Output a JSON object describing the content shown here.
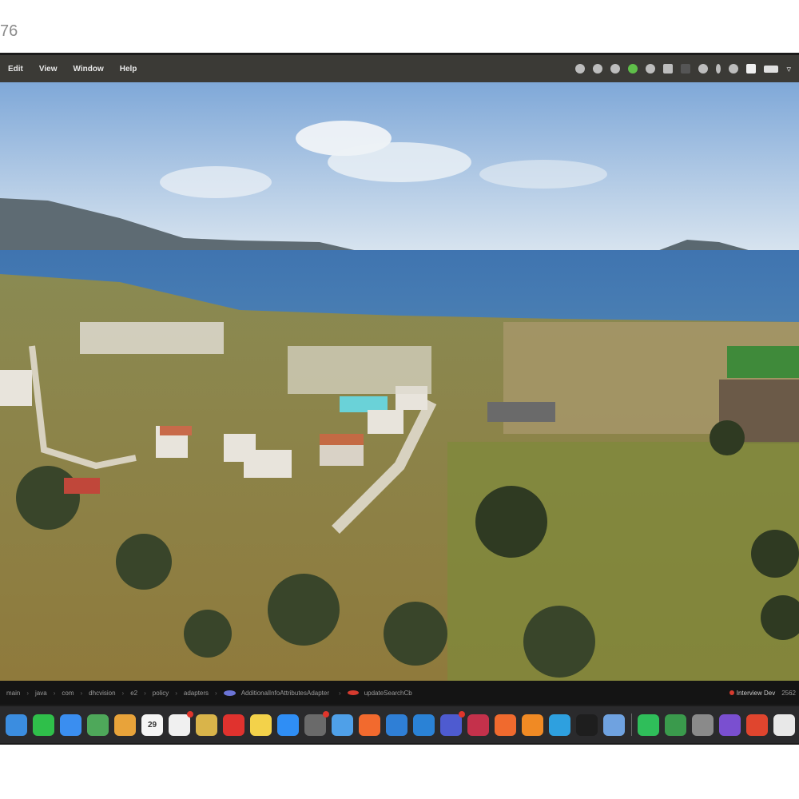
{
  "listing_number": "76",
  "menubar": {
    "menus": [
      "Edit",
      "View",
      "Window",
      "Help"
    ]
  },
  "status_icons": [
    "dropbox-icon",
    "system-icon",
    "system-icon",
    "evernote-icon",
    "system-icon",
    "shield-icon",
    "display-icon",
    "system-icon",
    "bluetooth-icon",
    "system-icon",
    "screen-icon",
    "battery-icon",
    "wifi-icon"
  ],
  "pathbar": {
    "crumbs": [
      "main",
      "java",
      "com",
      "dhcvision",
      "e2",
      "policy",
      "adapters"
    ],
    "class_name": "AdditionalInfoAttributesAdapter",
    "method_name": "updateSearchCb",
    "branch": "Interview Dev",
    "right_text": "2562"
  },
  "dock": {
    "calendar_date": "29",
    "apps": [
      {
        "name": "finder-icon",
        "color": "#3b8de0"
      },
      {
        "name": "messages-icon",
        "color": "#2fbf4a"
      },
      {
        "name": "mail-icon",
        "color": "#3a8ef0"
      },
      {
        "name": "maps-icon",
        "color": "#4ea85a"
      },
      {
        "name": "photos-icon",
        "color": "#e8a33a"
      },
      {
        "name": "calendar-icon",
        "color": "#f5f5f5"
      },
      {
        "name": "reminders-icon",
        "color": "#f0f0f0"
      },
      {
        "name": "notes-icon",
        "color": "#d9b44a"
      },
      {
        "name": "opera-icon",
        "color": "#e0322e"
      },
      {
        "name": "stickies-icon",
        "color": "#f3d24a"
      },
      {
        "name": "app-store-icon",
        "color": "#2f8ef5"
      },
      {
        "name": "chrome-dev-icon",
        "color": "#6a6a6a"
      },
      {
        "name": "finder-alt-icon",
        "color": "#4fa0e8"
      },
      {
        "name": "brave-icon",
        "color": "#f26a2e"
      },
      {
        "name": "docker-icon",
        "color": "#2f7fd6"
      },
      {
        "name": "vscode-icon",
        "color": "#2a82d6"
      },
      {
        "name": "teams-icon",
        "color": "#4e5bd0"
      },
      {
        "name": "intellij-icon",
        "color": "#c4314b"
      },
      {
        "name": "postman-icon",
        "color": "#f06a2e"
      },
      {
        "name": "sublime-icon",
        "color": "#f08a24"
      },
      {
        "name": "telegram-icon",
        "color": "#2ea0df"
      },
      {
        "name": "terminal-icon",
        "color": "#1e1e1e"
      },
      {
        "name": "xcode-icon",
        "color": "#6fa2e0"
      },
      {
        "name": "whatsapp-icon",
        "color": "#2fbe5a"
      },
      {
        "name": "excel-icon",
        "color": "#3a9a4c"
      },
      {
        "name": "system-prefs-icon",
        "color": "#8a8a8a"
      },
      {
        "name": "viber-icon",
        "color": "#7a4fd0"
      },
      {
        "name": "anydesk-icon",
        "color": "#e0452e"
      },
      {
        "name": "chrome-icon",
        "color": "#e8e8e8"
      },
      {
        "name": "safari-icon",
        "color": "#3a9fe8"
      }
    ]
  }
}
